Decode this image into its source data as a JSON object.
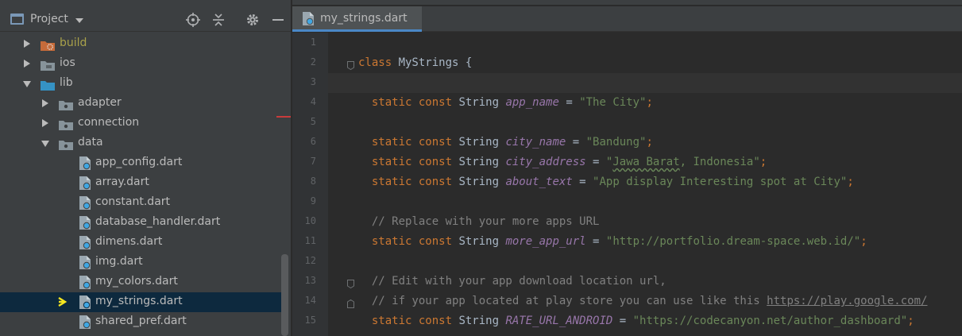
{
  "project_panel": {
    "title": "Project",
    "tree": [
      {
        "label": "build",
        "type": "folder-excluded",
        "expanded": false,
        "depth": 0
      },
      {
        "label": "ios",
        "type": "folder",
        "expanded": false,
        "depth": 0
      },
      {
        "label": "lib",
        "type": "folder-source",
        "expanded": true,
        "depth": 0
      },
      {
        "label": "adapter",
        "type": "folder",
        "expanded": false,
        "depth": 1
      },
      {
        "label": "connection",
        "type": "folder",
        "expanded": false,
        "depth": 1
      },
      {
        "label": "data",
        "type": "folder",
        "expanded": true,
        "depth": 1
      },
      {
        "label": "app_config.dart",
        "type": "dart-file",
        "depth": 2
      },
      {
        "label": "array.dart",
        "type": "dart-file",
        "depth": 2
      },
      {
        "label": "constant.dart",
        "type": "dart-file",
        "depth": 2
      },
      {
        "label": "database_handler.dart",
        "type": "dart-file",
        "depth": 2
      },
      {
        "label": "dimens.dart",
        "type": "dart-file",
        "depth": 2
      },
      {
        "label": "img.dart",
        "type": "dart-file",
        "depth": 2
      },
      {
        "label": "my_colors.dart",
        "type": "dart-file",
        "depth": 2
      },
      {
        "label": "my_strings.dart",
        "type": "dart-file",
        "depth": 2,
        "selected": true
      },
      {
        "label": "shared_pref.dart",
        "type": "dart-file",
        "depth": 2
      }
    ]
  },
  "editor": {
    "tab_label": "my_strings.dart",
    "current_line": 3,
    "lines": [
      {
        "n": "1",
        "tokens": []
      },
      {
        "n": "2",
        "tokens": [
          {
            "t": "class ",
            "c": "kw"
          },
          {
            "t": "MyStrings {",
            "c": ""
          }
        ]
      },
      {
        "n": "3",
        "tokens": []
      },
      {
        "n": "4",
        "tokens": [
          {
            "t": "  static const ",
            "c": "kw"
          },
          {
            "t": "String ",
            "c": ""
          },
          {
            "t": "app_name",
            "c": "fld"
          },
          {
            "t": " = ",
            "c": ""
          },
          {
            "t": "\"The City\"",
            "c": "str"
          },
          {
            "t": ";",
            "c": "kw"
          }
        ]
      },
      {
        "n": "5",
        "tokens": []
      },
      {
        "n": "6",
        "tokens": [
          {
            "t": "  static const ",
            "c": "kw"
          },
          {
            "t": "String ",
            "c": ""
          },
          {
            "t": "city_name",
            "c": "fld"
          },
          {
            "t": " = ",
            "c": ""
          },
          {
            "t": "\"Bandung\"",
            "c": "str"
          },
          {
            "t": ";",
            "c": "kw"
          }
        ]
      },
      {
        "n": "7",
        "tokens": [
          {
            "t": "  static const ",
            "c": "kw"
          },
          {
            "t": "String ",
            "c": ""
          },
          {
            "t": "city_address",
            "c": "fld"
          },
          {
            "t": " = ",
            "c": ""
          },
          {
            "t": "\"",
            "c": "str"
          },
          {
            "t": "Jawa Barat",
            "c": "str typo"
          },
          {
            "t": ", Indonesia\"",
            "c": "str"
          },
          {
            "t": ";",
            "c": "kw"
          }
        ]
      },
      {
        "n": "8",
        "tokens": [
          {
            "t": "  static const ",
            "c": "kw"
          },
          {
            "t": "String ",
            "c": ""
          },
          {
            "t": "about_text",
            "c": "fld"
          },
          {
            "t": " = ",
            "c": ""
          },
          {
            "t": "\"App display Interesting spot at City\"",
            "c": "str"
          },
          {
            "t": ";",
            "c": "kw"
          }
        ]
      },
      {
        "n": "9",
        "tokens": []
      },
      {
        "n": "10",
        "tokens": [
          {
            "t": "  // Replace with your more apps URL",
            "c": "cmt"
          }
        ]
      },
      {
        "n": "11",
        "tokens": [
          {
            "t": "  static const ",
            "c": "kw"
          },
          {
            "t": "String ",
            "c": ""
          },
          {
            "t": "more_app_url",
            "c": "fld"
          },
          {
            "t": " = ",
            "c": ""
          },
          {
            "t": "\"http://portfolio.dream-space.web.id/\"",
            "c": "str"
          },
          {
            "t": ";",
            "c": "kw"
          }
        ]
      },
      {
        "n": "12",
        "tokens": []
      },
      {
        "n": "13",
        "tokens": [
          {
            "t": "  // Edit with your app download location url,",
            "c": "cmt"
          }
        ]
      },
      {
        "n": "14",
        "tokens": [
          {
            "t": "  // if your app located at play store you can use like this ",
            "c": "cmt"
          },
          {
            "t": "https://play.google.com/",
            "c": "url"
          }
        ]
      },
      {
        "n": "15",
        "tokens": [
          {
            "t": "  static const ",
            "c": "kw"
          },
          {
            "t": "String ",
            "c": ""
          },
          {
            "t": "RATE_URL_ANDROID",
            "c": "fld"
          },
          {
            "t": " = ",
            "c": ""
          },
          {
            "t": "\"https://codecanyon.net/author_dashboard\"",
            "c": "str"
          },
          {
            "t": ";",
            "c": "kw"
          }
        ]
      }
    ]
  },
  "colors": {
    "panel_bg": "#3c3f41",
    "editor_bg": "#2b2b2b",
    "selection": "#0d293e",
    "keyword": "#cc7832",
    "field": "#9876aa",
    "string": "#6a8759",
    "comment": "#808080",
    "accent": "#4a88c7"
  },
  "icons": {
    "project": "project-window-icon",
    "locate": "crosshair-icon",
    "collapse": "collapse-all-icon",
    "settings": "gear-icon",
    "hide": "minimize-icon",
    "dart_file": "dart-file-icon",
    "folder": "folder-icon",
    "annotation": "yellow-arrow-icon"
  }
}
